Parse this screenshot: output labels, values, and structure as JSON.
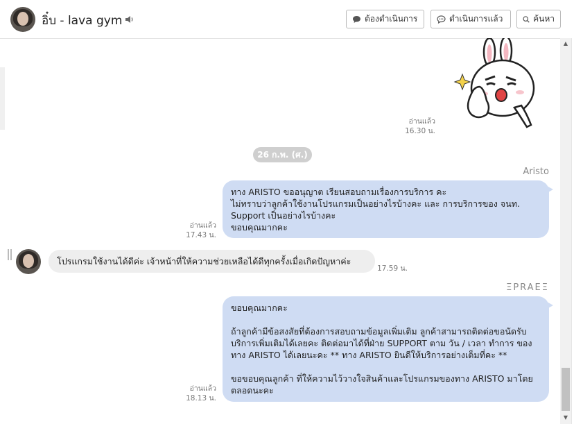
{
  "header": {
    "chat_name": "อิ๋บ - lava gym",
    "btn_todo": "ต้องดำเนินการ",
    "btn_done": "ดำเนินการแล้ว",
    "btn_search": "ค้นหา"
  },
  "messages": {
    "sticker": {
      "read": "อ่านแล้ว",
      "time": "16.30 น."
    },
    "date_separator": "26 ก.พ. (ศ.)",
    "msg1": {
      "sender": "Aristo",
      "text": "ทาง ARISTO ขออนุญาต เรียนสอบถามเรื่องการบริการ คะ\nไม่ทราบว่าลูกค้าใช้งานโปรแกรมเป็นอย่างไรบ้างคะ และ การบริการของ จนท. Support เป็นอย่างไรบ้างคะ\nขอบคุณมากคะ",
      "read": "อ่านแล้ว",
      "time": "17.43 น."
    },
    "msg2": {
      "text": "โปรแกรมใช้งานได้ดีค่ะ เจ้าหน้าที่ให้ความช่วยเหลือได้ดีทุกครั้งเมื่อเกิดปัญหาค่ะ",
      "time": "17.59 น."
    },
    "msg3": {
      "sender": "ΞPRAEΞ",
      "text": "ขอบคุณมากคะ\n\nถ้าลูกค้ามีข้อสงสัยที่ต้องการสอบถามข้อมูลเพิ่มเติม ลูกค้าสามารถติดต่อขอนัดรับบริการเพิ่มเติมได้เลยคะ ติดต่อมาได้ที่ฝ่าย SUPPORT ตาม วัน / เวลา ทำการ ของทาง ARISTO ได้เลยนะคะ ** ทาง ARISTO ยินดีให้บริการอย่างเต็มที่คะ **\n\nขอขอบคุณลูกค้า ที่ให้ความไว้วางใจสินค้าและโปรแกรมของทาง ARISTO มาโดยตลอดนะคะ",
      "read": "อ่านแล้ว",
      "time": "18.13 น."
    }
  }
}
